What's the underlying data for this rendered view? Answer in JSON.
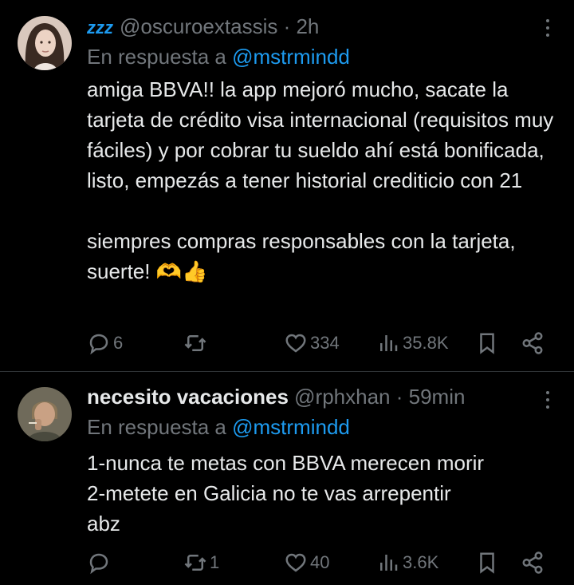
{
  "tweets": [
    {
      "display_name": "",
      "handle": "@oscuroextassis",
      "time": "2h",
      "reply_prefix": "En respuesta a",
      "reply_to": "@mstrmindd",
      "badge_text": "zzz",
      "paragraphs": [
        "amiga BBVA!! la app mejoró mucho, sacate la tarjeta de crédito visa internacional (requisitos muy fáciles) y por cobrar tu sueldo ahí está bonificada, listo, empezás a tener historial crediticio con 21",
        "siempres compras responsables con la tarjeta, suerte! 🫶👍"
      ],
      "stats": {
        "replies": "6",
        "reposts": "",
        "likes": "334",
        "views": "35.8K"
      }
    },
    {
      "display_name": "necesito vacaciones",
      "handle": "@rphxhan",
      "time": "59min",
      "reply_prefix": "En respuesta a",
      "reply_to": "@mstrmindd",
      "paragraphs": [
        "1-nunca te metas con BBVA merecen morir",
        "2-metete en Galicia no te vas arrepentir",
        "abz"
      ],
      "stats": {
        "replies": "",
        "reposts": "1",
        "likes": "40",
        "views": "3.6K"
      }
    }
  ],
  "colors": {
    "background": "#000000",
    "text": "#e7e9ea",
    "muted": "#71767b",
    "accent": "#1d9bf0",
    "divider": "#2f3336"
  },
  "icons": [
    "reply-icon",
    "repost-icon",
    "like-icon",
    "views-icon",
    "bookmark-icon",
    "share-icon",
    "more-icon",
    "zzz-icon"
  ]
}
